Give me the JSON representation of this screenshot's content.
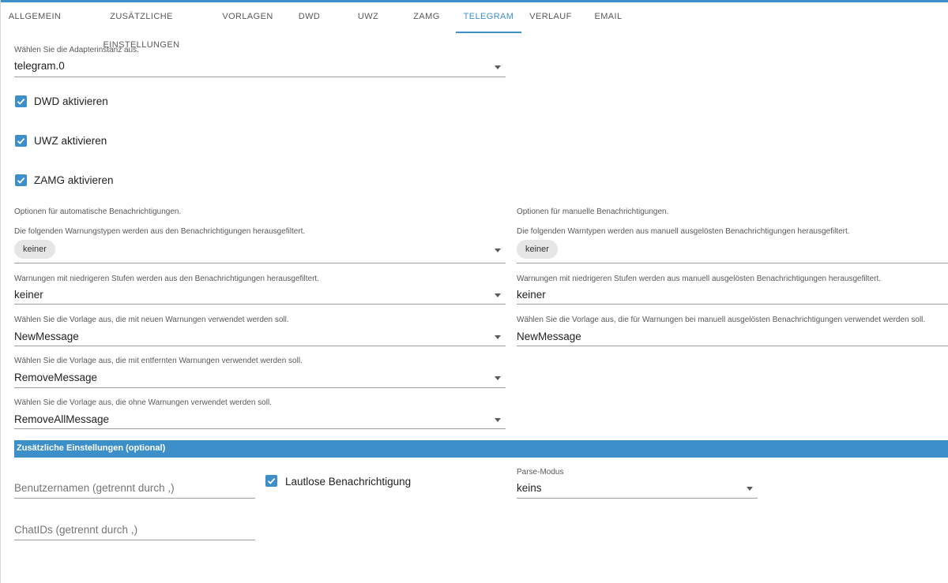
{
  "tabs": [
    {
      "label": "ALLGEMEIN"
    },
    {
      "label": "ZUSÄTZLICHE EINSTELLUNGEN"
    },
    {
      "label": "VORLAGEN"
    },
    {
      "label": "DWD"
    },
    {
      "label": "UWZ"
    },
    {
      "label": "ZAMG"
    },
    {
      "label": "TELEGRAM",
      "active": true
    },
    {
      "label": "VERLAUF"
    },
    {
      "label": "EMAIL"
    }
  ],
  "instance": {
    "label": "Wählen Sie die Adapterinstanz aus.",
    "value": "telegram.0"
  },
  "checkboxes": {
    "dwd": {
      "label": "DWD aktivieren",
      "checked": true
    },
    "uwz": {
      "label": "UWZ aktivieren",
      "checked": true
    },
    "zamg": {
      "label": "ZAMG aktivieren",
      "checked": true
    }
  },
  "auto": {
    "heading": "Optionen für automatische Benachrichtigungen.",
    "filter_types": {
      "label": "Die folgenden Warnungstypen werden aus den Benachrichtigungen herausgefiltert.",
      "chip": "keiner"
    },
    "filter_level": {
      "label": "Warnungen mit niedrigeren Stufen werden aus den Benachrichtigungen herausgefiltert.",
      "value": "keiner"
    },
    "template_new": {
      "label": "Wählen Sie die Vorlage aus, die mit neuen Warnungen verwendet werden soll.",
      "value": "NewMessage"
    },
    "template_removed": {
      "label": "Wählen Sie die Vorlage aus, die mit entfernten Warnungen verwendet werden soll.",
      "value": "RemoveMessage"
    },
    "template_none": {
      "label": "Wählen Sie die Vorlage aus, die ohne Warnungen verwendet werden soll.",
      "value": "RemoveAllMessage"
    }
  },
  "manual": {
    "heading": "Optionen für manuelle Benachrichtigungen.",
    "filter_types": {
      "label": "Die folgenden Warntypen werden aus manuell ausgelösten Benachrichtigungen herausgefiltert.",
      "chip": "keiner"
    },
    "filter_level": {
      "label": "Warnungen mit niedrigeren Stufen werden aus manuell ausgelösten Benachrichtigungen herausgefiltert.",
      "value": "keiner"
    },
    "template": {
      "label": "Wählen Sie die Vorlage aus, die für Warnungen bei manuell ausgelösten Benachrichtigungen verwendet werden soll.",
      "value": "NewMessage"
    }
  },
  "extra": {
    "header": "Zusätzliche Einstellungen (optional)",
    "usernames_placeholder": "Benutzernamen (getrennt durch ,)",
    "chatids_placeholder": "ChatIDs (getrennt durch ,)",
    "silent": {
      "label": "Lautlose Benachrichtigung",
      "checked": true
    },
    "parse_mode": {
      "label": "Parse-Modus",
      "value": "keins"
    }
  },
  "colors": {
    "accent": "#3d8fc9",
    "chip_bg": "#e6e6e6"
  },
  "icons": {
    "checkbox": "check-icon",
    "dropdown": "triangle-down-icon"
  }
}
